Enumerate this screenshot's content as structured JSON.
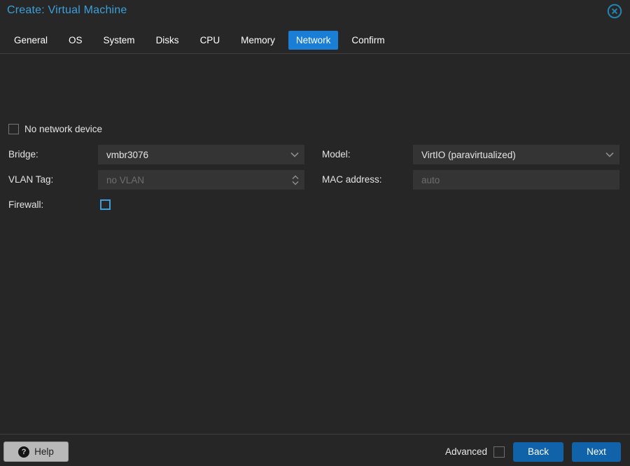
{
  "window": {
    "title": "Create: Virtual Machine",
    "close_icon": "circle-x-icon"
  },
  "tabs": [
    {
      "label": "General",
      "active": false
    },
    {
      "label": "OS",
      "active": false
    },
    {
      "label": "System",
      "active": false
    },
    {
      "label": "Disks",
      "active": false
    },
    {
      "label": "CPU",
      "active": false
    },
    {
      "label": "Memory",
      "active": false
    },
    {
      "label": "Network",
      "active": true
    },
    {
      "label": "Confirm",
      "active": false
    }
  ],
  "form": {
    "no_network_device": {
      "label": "No network device",
      "checked": false
    },
    "bridge": {
      "label": "Bridge:",
      "value": "vmbr3076",
      "control": "dropdown"
    },
    "model": {
      "label": "Model:",
      "value": "VirtIO (paravirtualized)",
      "control": "dropdown"
    },
    "vlan_tag": {
      "label": "VLAN Tag:",
      "value": "",
      "placeholder": "no VLAN",
      "control": "number-spinner"
    },
    "mac_address": {
      "label": "MAC address:",
      "value": "",
      "placeholder": "auto",
      "control": "text-input"
    },
    "firewall": {
      "label": "Firewall:",
      "checked": false
    }
  },
  "footer": {
    "help_label": "Help",
    "help_icon": "question-mark-icon",
    "advanced_label": "Advanced",
    "advanced_checked": false,
    "back_label": "Back",
    "next_label": "Next"
  },
  "colors": {
    "background": "#262626",
    "field_background": "#343434",
    "title_blue": "#3ba0dc",
    "active_tab_blue": "#1a7fd4",
    "button_blue": "#1063a9",
    "focus_checkbox_blue": "#3f9ddb",
    "placeholder_gray": "#6e6e6e",
    "separator_gray": "#404040"
  }
}
